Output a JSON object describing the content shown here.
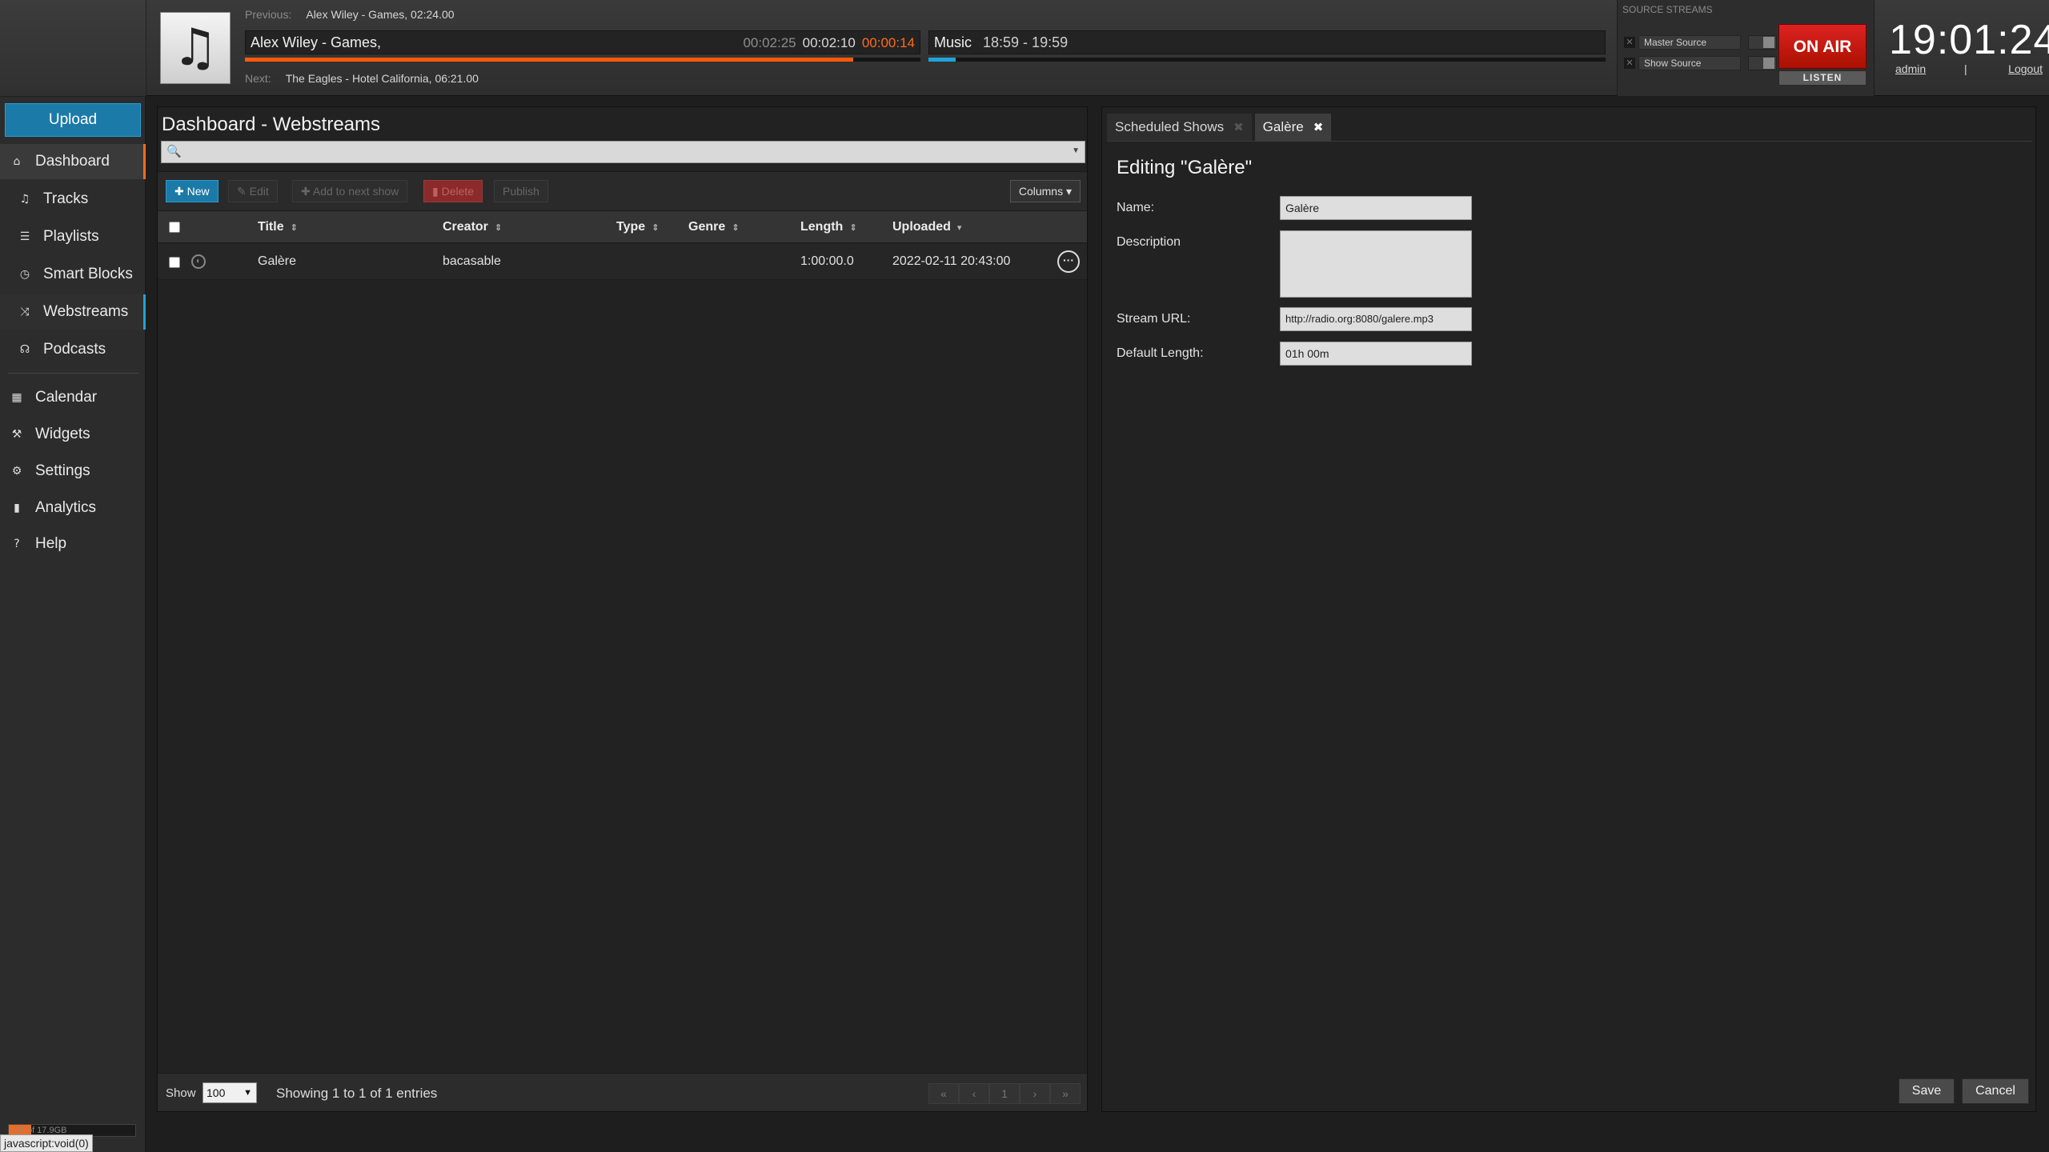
{
  "now_playing": {
    "previous_label": "Previous:",
    "previous_value": "Alex Wiley - Games, 02:24.00",
    "current_title": "Alex Wiley - Games,",
    "elapsed": "00:02:25",
    "total": "00:02:10",
    "remaining": "00:00:14",
    "progress_fraction": 0.9,
    "next_label": "Next:",
    "next_value": "The Eagles - Hotel California, 06:21.00"
  },
  "show": {
    "name": "Music",
    "time": "18:59 - 19:59",
    "progress_fraction": 0.04
  },
  "source_streams": {
    "heading": "SOURCE STREAMS",
    "master": "Master Source",
    "show": "Show Source",
    "on_air": "ON AIR",
    "listen": "LISTEN"
  },
  "clock": "19:01:24",
  "user": {
    "name": "admin",
    "separator": "|",
    "logout": "Logout"
  },
  "sidebar": {
    "upload": "Upload",
    "items": [
      {
        "label": "Dashboard",
        "icon": "home-icon",
        "glyph": "⌂"
      },
      {
        "label": "Tracks",
        "icon": "music-icon",
        "glyph": "♫"
      },
      {
        "label": "Playlists",
        "icon": "list-icon",
        "glyph": "☰"
      },
      {
        "label": "Smart Blocks",
        "icon": "clock-icon",
        "glyph": "◷"
      },
      {
        "label": "Webstreams",
        "icon": "shuffle-icon",
        "glyph": "⤨"
      },
      {
        "label": "Podcasts",
        "icon": "headphones-icon",
        "glyph": "☊"
      },
      {
        "label": "Calendar",
        "icon": "calendar-icon",
        "glyph": "▦"
      },
      {
        "label": "Widgets",
        "icon": "wrench-icon",
        "glyph": "⚒"
      },
      {
        "label": "Settings",
        "icon": "gear-icon",
        "glyph": "⚙"
      },
      {
        "label": "Analytics",
        "icon": "bar-chart-icon",
        "glyph": "▮"
      },
      {
        "label": "Help",
        "icon": "question-icon",
        "glyph": "?"
      }
    ],
    "storage_text": "GB of 17.9GB",
    "storage_fraction": 0.18
  },
  "status_url": "javascript:void(0)",
  "library": {
    "title": "Dashboard - Webstreams",
    "search_icon": "🔍",
    "toolbar": {
      "new": "New",
      "edit": "Edit",
      "add_to_next": "Add to next show",
      "delete": "Delete",
      "publish": "Publish",
      "columns": "Columns"
    },
    "columns": [
      "Title",
      "Creator",
      "Type",
      "Genre",
      "Length",
      "Uploaded"
    ],
    "rows": [
      {
        "title": "Galère",
        "creator": "bacasable",
        "type": "",
        "genre": "",
        "length": "1:00:00.0",
        "uploaded": "2022-02-11 20:43:00"
      }
    ],
    "footer": {
      "show_label": "Show",
      "page_size": "100",
      "showing": "Showing 1 to 1 of 1 entries",
      "pager": [
        "«",
        "‹",
        "1",
        "›",
        "»"
      ]
    }
  },
  "editor": {
    "tabs": [
      "Scheduled Shows",
      "Galère"
    ],
    "heading": "Editing \"Galère\"",
    "fields": {
      "name_label": "Name:",
      "name_value": "Galère",
      "description_label": "Description",
      "description_value": "",
      "url_label": "Stream URL:",
      "url_value": "http://radio.org:8080/galere.mp3",
      "length_label": "Default Length:",
      "length_value": "01h 00m"
    },
    "save": "Save",
    "cancel": "Cancel"
  }
}
